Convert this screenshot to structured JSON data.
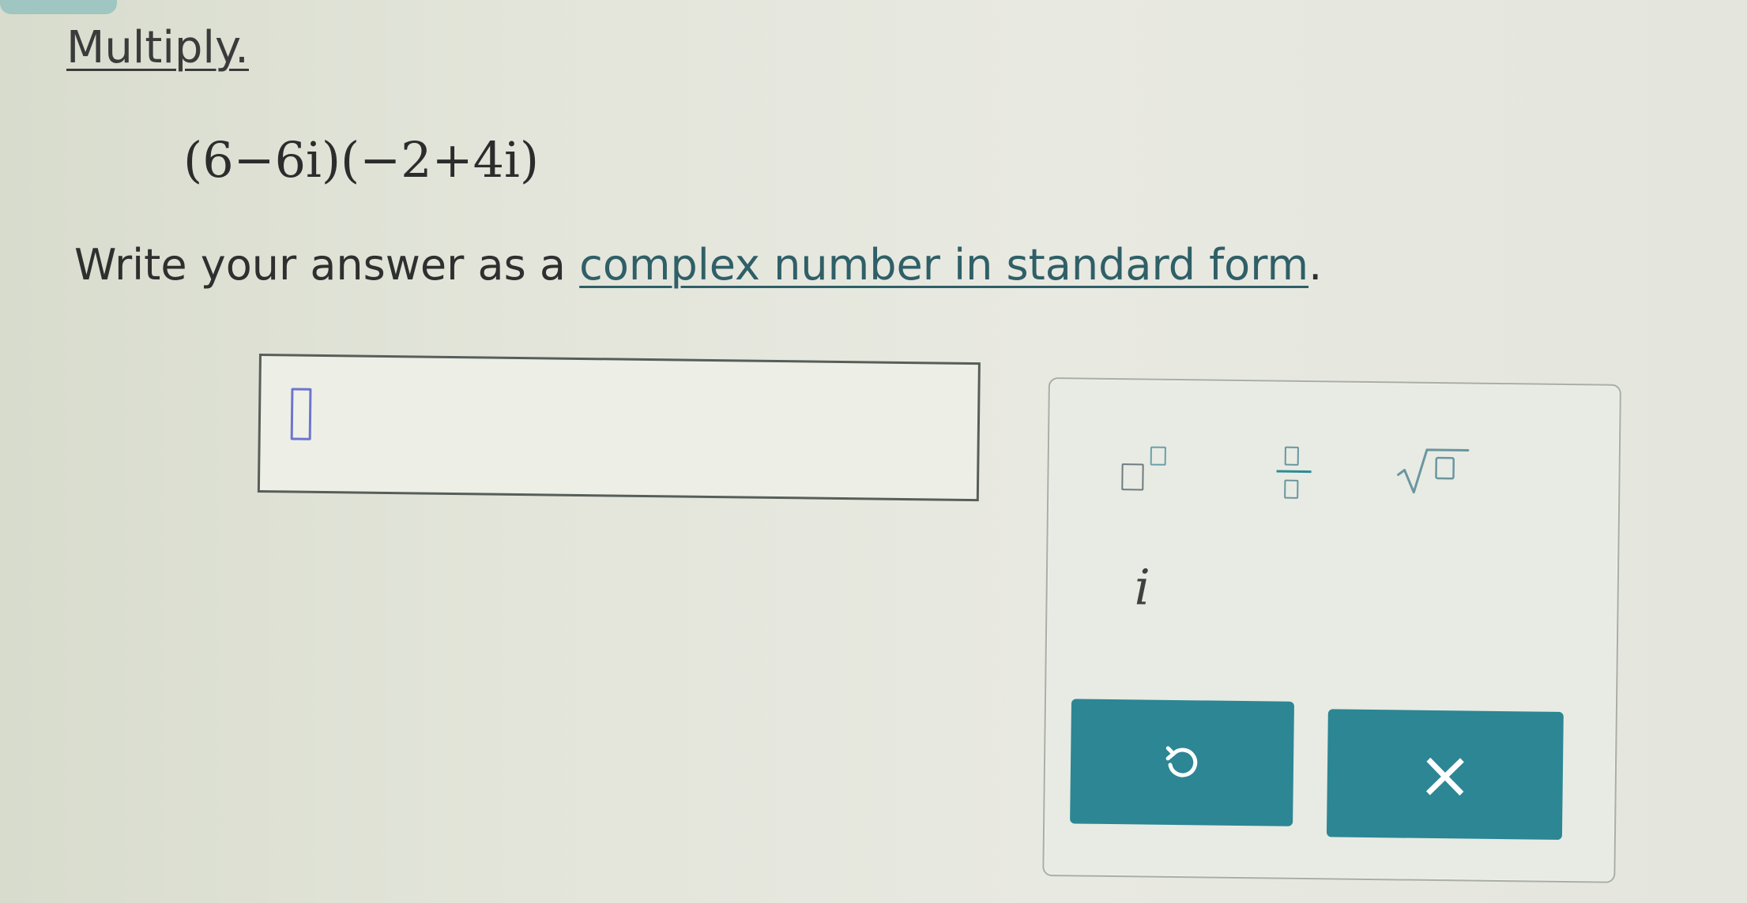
{
  "problem": {
    "instruction": "Multiply.",
    "expression": "(6−6i)(−2+4i)",
    "sentence_prefix": "Write your answer as a ",
    "sentence_link": "complex number in standard form",
    "sentence_suffix": "."
  },
  "answer": {
    "value": ""
  },
  "keypad": {
    "i_key": "i",
    "clear_label": "×"
  },
  "icons": {
    "exponent": "exponent-template-icon",
    "fraction": "fraction-template-icon",
    "sqrt": "square-root-template-icon",
    "undo": "undo-icon",
    "clear": "close-icon"
  },
  "colors": {
    "accent": "#2c8694",
    "cursor": "#6d75ce"
  }
}
